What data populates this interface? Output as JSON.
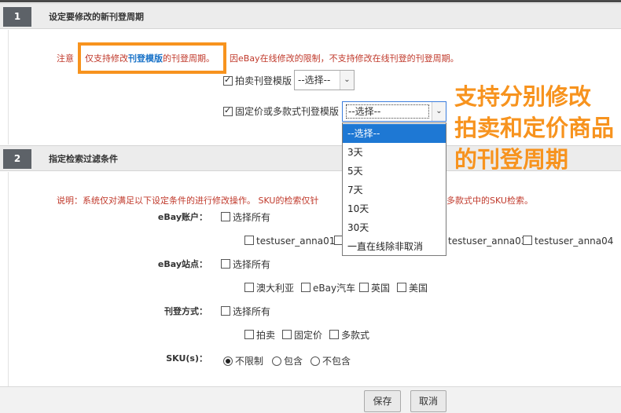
{
  "section1": {
    "number": "1",
    "title": "设定要修改的新刊登周期",
    "note_prefix": "注意",
    "note_hl_pre": "仅支持修改",
    "note_hl_link": "刊登模版",
    "note_hl_post": "的刊登周期。",
    "note_rest": "因eBay在线修改的限制，不支持修改在线刊登的刊登周期。",
    "auction_label": "拍卖刊登模版",
    "auction_select_value": "--选择--",
    "fixed_label": "固定价或多款式刊登模版",
    "fixed_select_value": "--选择--"
  },
  "dropdown": {
    "options": [
      "--选择--",
      "3天",
      "5天",
      "7天",
      "10天",
      "30天",
      "一直在线除非取消"
    ],
    "selected_index": 0
  },
  "annotation": {
    "lines": [
      "支持分别修改",
      "拍卖和定价商品",
      "的刊登周期"
    ],
    "color": "#f7931e"
  },
  "section2": {
    "number": "2",
    "title": "指定检索过滤条件",
    "note_left": "说明：系统仅对满足以下设定条件的进行修改操作。 SKU的检索仅针",
    "note_right": "多款式中的SKU检索。",
    "account_label": "eBay账户：",
    "account_all": "选择所有",
    "accounts": [
      "testuser_anna01",
      "testuser_anna03",
      "testuser_anna04"
    ],
    "site_label": "eBay站点：",
    "site_all": "选择所有",
    "sites": [
      "澳大利亚",
      "eBay汽车",
      "英国",
      "美国"
    ],
    "format_label": "刊登方式：",
    "format_all": "选择所有",
    "formats": [
      "拍卖",
      "固定价",
      "多款式"
    ],
    "sku_label": "SKU(s)：",
    "sku_options": [
      "不限制",
      "包含",
      "不包含"
    ],
    "sku_selected": 0
  },
  "footer": {
    "save_label": "保存",
    "cancel_label": "取消"
  }
}
